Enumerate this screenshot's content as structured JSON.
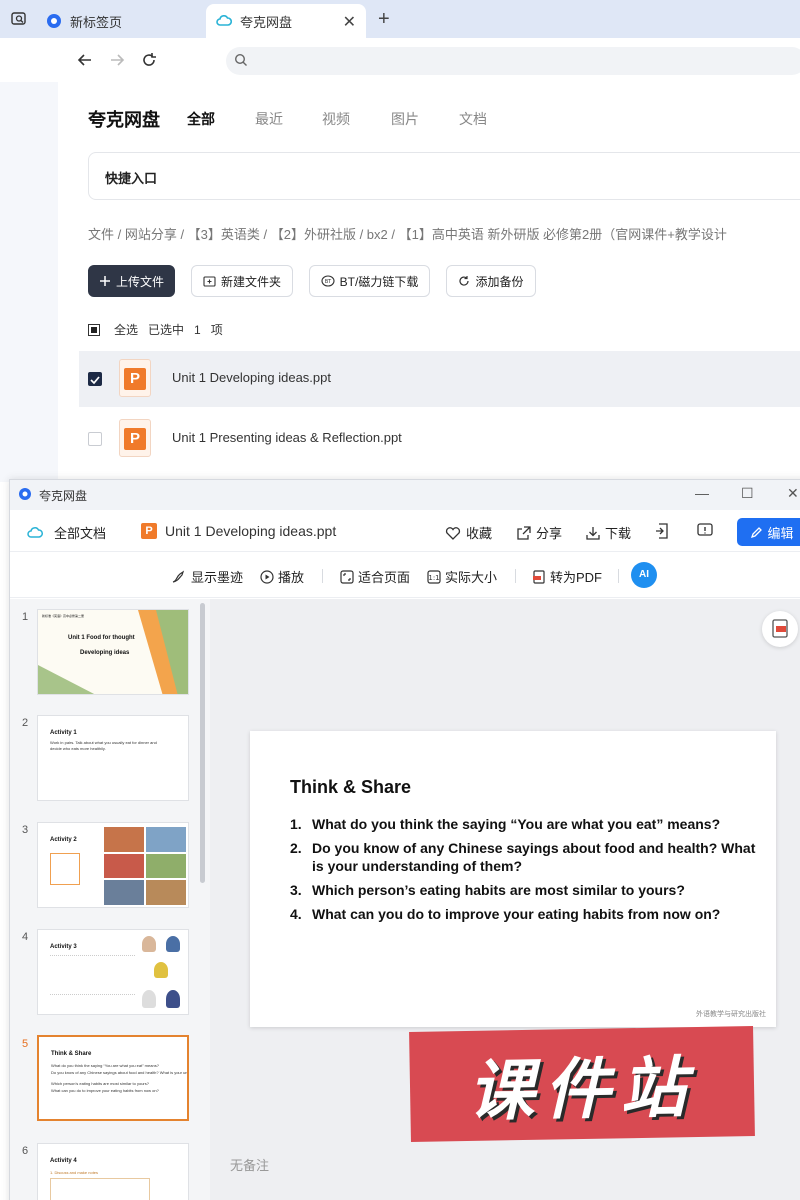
{
  "browser": {
    "tabs": [
      {
        "label": "新标签页",
        "icon": "quark-logo-icon"
      },
      {
        "label": "夸克网盘",
        "icon": "cloud-icon"
      }
    ],
    "new_tab": "+",
    "close_tab": "✕"
  },
  "page": {
    "brand": "夸克网盘",
    "nav": [
      "全部",
      "最近",
      "视频",
      "图片",
      "文档"
    ],
    "quick_entry": "快捷入口",
    "breadcrumb": "文件 / 网站分享 / 【3】英语类 / 【2】外研社版 / bx2 / 【1】高中英语 新外研版 必修第2册（官网课件+教学设计",
    "buttons": {
      "upload": "上传文件",
      "new_folder": "新建文件夹",
      "bt": "BT/磁力链下载",
      "backup": "添加备份"
    },
    "selection": {
      "select_all": "全选",
      "selected": "已选中",
      "count": "1",
      "unit": "项"
    },
    "files": [
      {
        "name": "Unit 1 Developing ideas.ppt",
        "checked": true
      },
      {
        "name": "Unit 1 Presenting ideas & Reflection.ppt",
        "checked": false
      }
    ]
  },
  "viewer": {
    "window_title": "夸克网盘",
    "all_docs": "全部文档",
    "file_name": "Unit 1 Developing ideas.ppt",
    "actions": {
      "favorite": "收藏",
      "share": "分享",
      "download": "下载",
      "edit": "编辑"
    },
    "tools": {
      "ink": "显示墨迹",
      "play": "播放",
      "fit": "适合页面",
      "actual": "实际大小",
      "to_pdf": "转为PDF",
      "ai": "AI"
    },
    "thumbnails": [
      {
        "num": "1",
        "title": "Unit 1 Food for thought",
        "subtitle": "Developing ideas",
        "header": "新标准《英语》高中必修第二册"
      },
      {
        "num": "2",
        "title": "Activity 1",
        "lines": [
          "Work in pairs. Talk about what you usually eat for dinner and",
          "decide who eats more healthily."
        ]
      },
      {
        "num": "3",
        "title": "Activity 2"
      },
      {
        "num": "4",
        "title": "Activity 3"
      },
      {
        "num": "5",
        "title": "Think & Share"
      },
      {
        "num": "6",
        "title": "Activity 4",
        "lines": [
          "1. Discuss and make notes"
        ]
      }
    ],
    "current_slide": {
      "title": "Think & Share",
      "items": [
        {
          "n": "1.",
          "text": "What do you think the saying “You are what you eat” means?"
        },
        {
          "n": "2.",
          "text": "Do you know of any Chinese sayings about food and health? What is your understanding of them?"
        },
        {
          "n": "3.",
          "text": "Which person’s eating habits are most similar to yours?"
        },
        {
          "n": "4.",
          "text": "What can you do to improve your eating habits from now on?"
        }
      ],
      "publisher": "外语教学与研究出版社"
    },
    "notes": "无备注"
  },
  "watermark": "课件站",
  "colors": {
    "accent": "#1f6ff2",
    "ppt": "#f07a2a",
    "dark_button": "#2f3646",
    "stamp": "#d84a52"
  }
}
